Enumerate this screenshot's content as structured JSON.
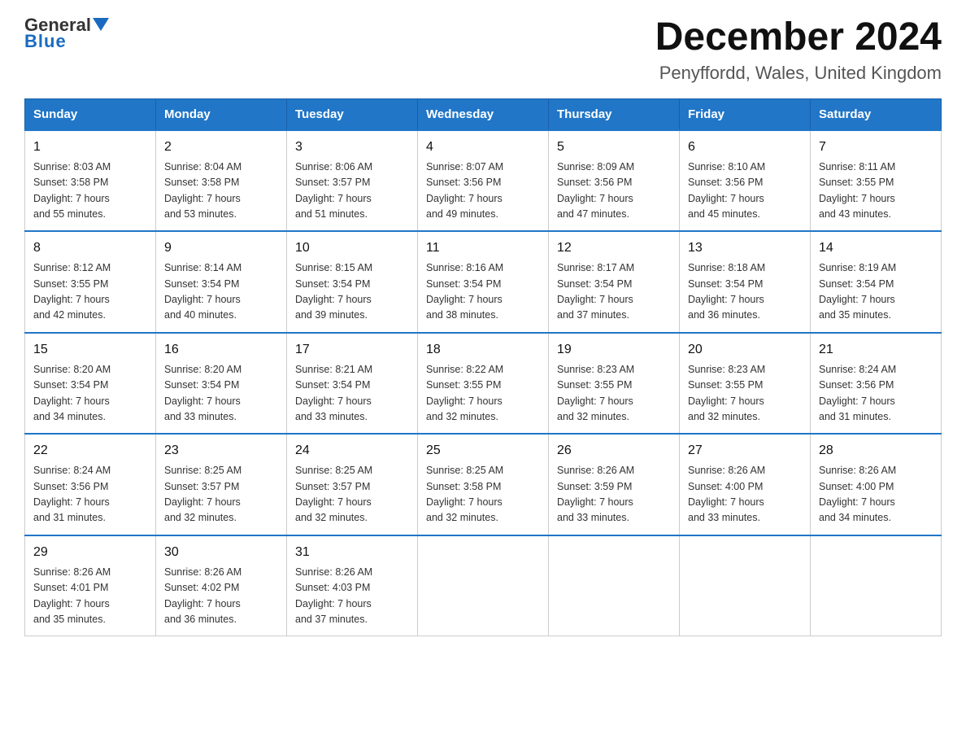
{
  "header": {
    "logo": {
      "line1": "General",
      "line2": "Blue"
    },
    "title": "December 2024",
    "location": "Penyffordd, Wales, United Kingdom"
  },
  "days_of_week": [
    "Sunday",
    "Monday",
    "Tuesday",
    "Wednesday",
    "Thursday",
    "Friday",
    "Saturday"
  ],
  "weeks": [
    [
      {
        "day": "1",
        "sunrise": "8:03 AM",
        "sunset": "3:58 PM",
        "daylight": "7 hours and 55 minutes."
      },
      {
        "day": "2",
        "sunrise": "8:04 AM",
        "sunset": "3:58 PM",
        "daylight": "7 hours and 53 minutes."
      },
      {
        "day": "3",
        "sunrise": "8:06 AM",
        "sunset": "3:57 PM",
        "daylight": "7 hours and 51 minutes."
      },
      {
        "day": "4",
        "sunrise": "8:07 AM",
        "sunset": "3:56 PM",
        "daylight": "7 hours and 49 minutes."
      },
      {
        "day": "5",
        "sunrise": "8:09 AM",
        "sunset": "3:56 PM",
        "daylight": "7 hours and 47 minutes."
      },
      {
        "day": "6",
        "sunrise": "8:10 AM",
        "sunset": "3:56 PM",
        "daylight": "7 hours and 45 minutes."
      },
      {
        "day": "7",
        "sunrise": "8:11 AM",
        "sunset": "3:55 PM",
        "daylight": "7 hours and 43 minutes."
      }
    ],
    [
      {
        "day": "8",
        "sunrise": "8:12 AM",
        "sunset": "3:55 PM",
        "daylight": "7 hours and 42 minutes."
      },
      {
        "day": "9",
        "sunrise": "8:14 AM",
        "sunset": "3:54 PM",
        "daylight": "7 hours and 40 minutes."
      },
      {
        "day": "10",
        "sunrise": "8:15 AM",
        "sunset": "3:54 PM",
        "daylight": "7 hours and 39 minutes."
      },
      {
        "day": "11",
        "sunrise": "8:16 AM",
        "sunset": "3:54 PM",
        "daylight": "7 hours and 38 minutes."
      },
      {
        "day": "12",
        "sunrise": "8:17 AM",
        "sunset": "3:54 PM",
        "daylight": "7 hours and 37 minutes."
      },
      {
        "day": "13",
        "sunrise": "8:18 AM",
        "sunset": "3:54 PM",
        "daylight": "7 hours and 36 minutes."
      },
      {
        "day": "14",
        "sunrise": "8:19 AM",
        "sunset": "3:54 PM",
        "daylight": "7 hours and 35 minutes."
      }
    ],
    [
      {
        "day": "15",
        "sunrise": "8:20 AM",
        "sunset": "3:54 PM",
        "daylight": "7 hours and 34 minutes."
      },
      {
        "day": "16",
        "sunrise": "8:20 AM",
        "sunset": "3:54 PM",
        "daylight": "7 hours and 33 minutes."
      },
      {
        "day": "17",
        "sunrise": "8:21 AM",
        "sunset": "3:54 PM",
        "daylight": "7 hours and 33 minutes."
      },
      {
        "day": "18",
        "sunrise": "8:22 AM",
        "sunset": "3:55 PM",
        "daylight": "7 hours and 32 minutes."
      },
      {
        "day": "19",
        "sunrise": "8:23 AM",
        "sunset": "3:55 PM",
        "daylight": "7 hours and 32 minutes."
      },
      {
        "day": "20",
        "sunrise": "8:23 AM",
        "sunset": "3:55 PM",
        "daylight": "7 hours and 32 minutes."
      },
      {
        "day": "21",
        "sunrise": "8:24 AM",
        "sunset": "3:56 PM",
        "daylight": "7 hours and 31 minutes."
      }
    ],
    [
      {
        "day": "22",
        "sunrise": "8:24 AM",
        "sunset": "3:56 PM",
        "daylight": "7 hours and 31 minutes."
      },
      {
        "day": "23",
        "sunrise": "8:25 AM",
        "sunset": "3:57 PM",
        "daylight": "7 hours and 32 minutes."
      },
      {
        "day": "24",
        "sunrise": "8:25 AM",
        "sunset": "3:57 PM",
        "daylight": "7 hours and 32 minutes."
      },
      {
        "day": "25",
        "sunrise": "8:25 AM",
        "sunset": "3:58 PM",
        "daylight": "7 hours and 32 minutes."
      },
      {
        "day": "26",
        "sunrise": "8:26 AM",
        "sunset": "3:59 PM",
        "daylight": "7 hours and 33 minutes."
      },
      {
        "day": "27",
        "sunrise": "8:26 AM",
        "sunset": "4:00 PM",
        "daylight": "7 hours and 33 minutes."
      },
      {
        "day": "28",
        "sunrise": "8:26 AM",
        "sunset": "4:00 PM",
        "daylight": "7 hours and 34 minutes."
      }
    ],
    [
      {
        "day": "29",
        "sunrise": "8:26 AM",
        "sunset": "4:01 PM",
        "daylight": "7 hours and 35 minutes."
      },
      {
        "day": "30",
        "sunrise": "8:26 AM",
        "sunset": "4:02 PM",
        "daylight": "7 hours and 36 minutes."
      },
      {
        "day": "31",
        "sunrise": "8:26 AM",
        "sunset": "4:03 PM",
        "daylight": "7 hours and 37 minutes."
      },
      null,
      null,
      null,
      null
    ]
  ],
  "labels": {
    "sunrise": "Sunrise:",
    "sunset": "Sunset:",
    "daylight": "Daylight:"
  }
}
